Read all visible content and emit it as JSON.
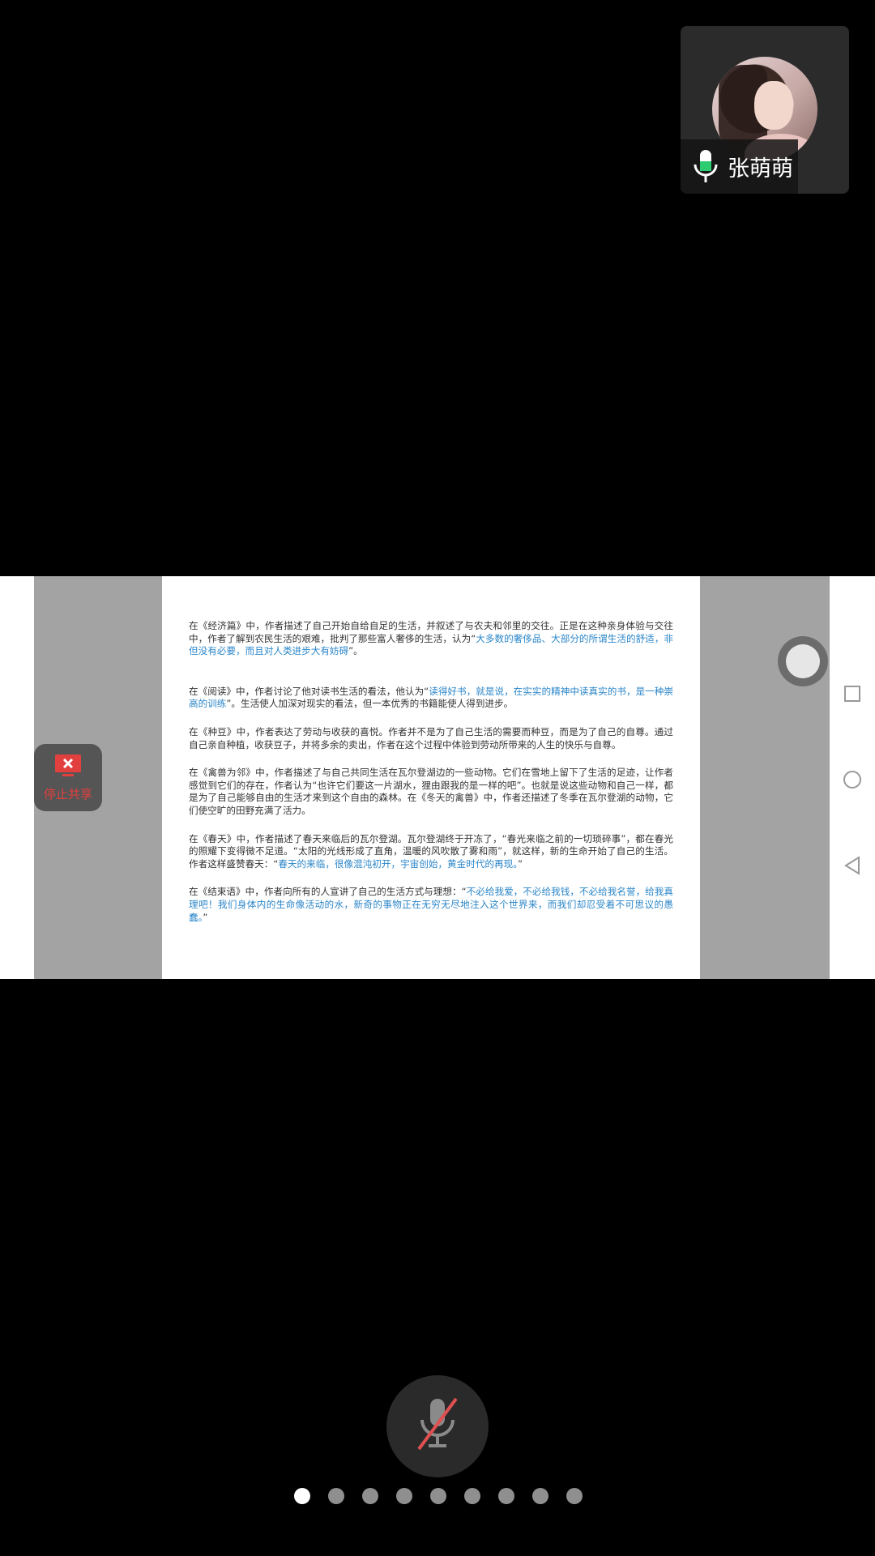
{
  "participant": {
    "name": "张萌萌",
    "mic_icon": "microphone-icon",
    "mic_color": "#2ecc71"
  },
  "shared_screen": {
    "paragraphs": [
      {
        "parts": [
          {
            "text": "在《经济篇》中，作者描述了自己开始自给自足的生活，并叙述了与农夫和邻里的交往。正是在这种亲身体验与交往中，作者了解到农民生活的艰难，批判了那些富人奢侈的生活，认为“",
            "hl": false
          },
          {
            "text": "大多数的奢侈品、大部分的所谓生活的舒适，非但没有必要，而且对人类进步大有妨碍",
            "hl": true
          },
          {
            "text": "”。",
            "hl": false
          }
        ]
      },
      {
        "parts": [
          {
            "text": "在《阅读》中，作者讨论了他对读书生活的看法，他认为“",
            "hl": false
          },
          {
            "text": "读得好书，就是说，在实实的精神中读真实的书，是一种崇高的训练",
            "hl": true
          },
          {
            "text": "”。生活使人加深对现实的看法，但一本优秀的书籍能使人得到进步。",
            "hl": false
          }
        ]
      },
      {
        "parts": [
          {
            "text": "在《种豆》中，作者表达了劳动与收获的喜悦。作者并不是为了自己生活的需要而种豆，而是为了自己的自尊。通过自己亲自种植，收获豆子，并将多余的卖出，作者在这个过程中体验到劳动所带来的人生的快乐与自尊。",
            "hl": false
          }
        ]
      },
      {
        "parts": [
          {
            "text": "在《禽兽为邻》中，作者描述了与自己共同生活在瓦尔登湖边的一些动物。它们在雪地上留下了生活的足迹，让作者感觉到它们的存在，作者认为“也许它们要这一片湖水，狸由跟我的是一样的吧”。也就是说这些动物和自己一样，都是为了自己能够自由的生活才来到这个自由的森林。在《冬天的禽兽》中，作者还描述了冬季在瓦尔登湖的动物，它们使空旷的田野充满了活力。",
            "hl": false
          }
        ]
      },
      {
        "parts": [
          {
            "text": "在《春天》中，作者描述了春天来临后的瓦尔登湖。瓦尔登湖终于开冻了，“春光来临之前的一切琐碎事”，都在春光的照耀下变得微不足道。“太阳的光线形成了直角，温暖的风吹散了雾和雨”，就这样，新的生命开始了自己的生活。作者这样盛赞春天：“",
            "hl": false
          },
          {
            "text": "春天的来临，很像混沌初开，宇宙创始，黄金时代的再现。",
            "hl": true
          },
          {
            "text": "”",
            "hl": false
          }
        ]
      },
      {
        "parts": [
          {
            "text": "在《结束语》中，作者向所有的人宣讲了自己的生活方式与理想：“",
            "hl": false
          },
          {
            "text": "不必给我爱，不必给我钱，不必给我名誉，给我真理吧！我们身体内的生命像活动的水，新奇的事物正在无穷无尽地注入这个世界来，而我们却忍受着不可思议的愚蠢。",
            "hl": true
          },
          {
            "text": "”",
            "hl": false
          }
        ]
      }
    ],
    "highlight_color": "#2a86c9"
  },
  "stop_share": {
    "label": "停止共享",
    "icon": "stop-share-screen-icon",
    "color": "#e23f3f"
  },
  "nav": {
    "recent_icon": "square-recent-icon",
    "home_icon": "circle-home-icon",
    "back_icon": "triangle-back-icon"
  },
  "controls": {
    "mute_icon": "microphone-muted-icon",
    "mute_slash_color": "#e05050"
  },
  "pager": {
    "total": 9,
    "active_index": 0
  }
}
